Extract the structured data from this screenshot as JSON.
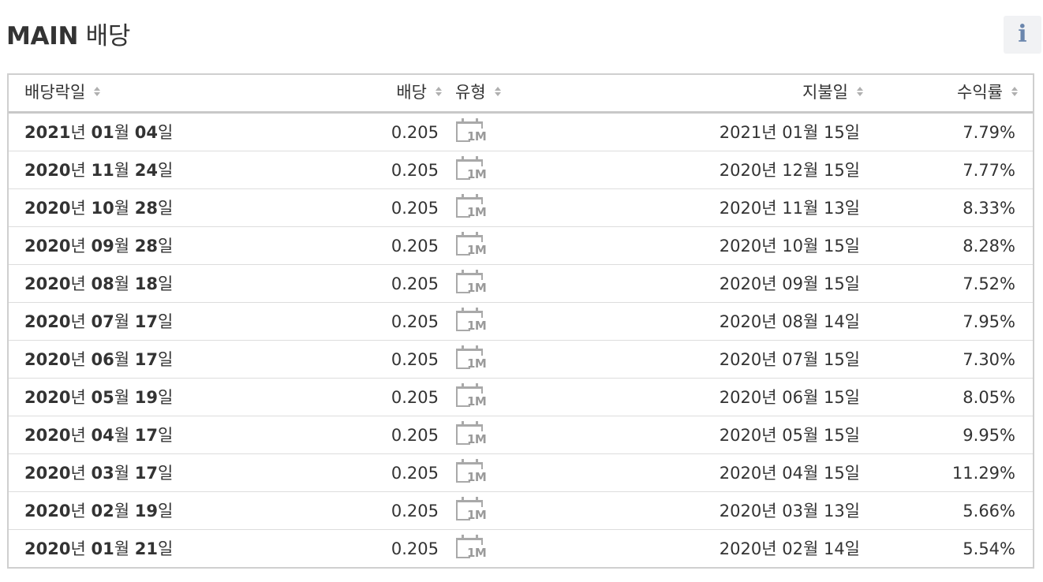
{
  "page": {
    "title_bold": "MAIN",
    "title_rest": " 배당",
    "info_glyph": "i"
  },
  "table": {
    "columns": {
      "ex_date": "배당락일",
      "amount": "배당",
      "type": "유형",
      "pay_date": "지불일",
      "yield": "수익률"
    },
    "rows": [
      {
        "ex_y": "2021",
        "ex_m": "01",
        "ex_d": "04",
        "amount": "0.205",
        "type": "1M",
        "pay_date": "2021년 01월 15일",
        "yield": "7.79%"
      },
      {
        "ex_y": "2020",
        "ex_m": "11",
        "ex_d": "24",
        "amount": "0.205",
        "type": "1M",
        "pay_date": "2020년 12월 15일",
        "yield": "7.77%"
      },
      {
        "ex_y": "2020",
        "ex_m": "10",
        "ex_d": "28",
        "amount": "0.205",
        "type": "1M",
        "pay_date": "2020년 11월 13일",
        "yield": "8.33%"
      },
      {
        "ex_y": "2020",
        "ex_m": "09",
        "ex_d": "28",
        "amount": "0.205",
        "type": "1M",
        "pay_date": "2020년 10월 15일",
        "yield": "8.28%"
      },
      {
        "ex_y": "2020",
        "ex_m": "08",
        "ex_d": "18",
        "amount": "0.205",
        "type": "1M",
        "pay_date": "2020년 09월 15일",
        "yield": "7.52%"
      },
      {
        "ex_y": "2020",
        "ex_m": "07",
        "ex_d": "17",
        "amount": "0.205",
        "type": "1M",
        "pay_date": "2020년 08월 14일",
        "yield": "7.95%"
      },
      {
        "ex_y": "2020",
        "ex_m": "06",
        "ex_d": "17",
        "amount": "0.205",
        "type": "1M",
        "pay_date": "2020년 07월 15일",
        "yield": "7.30%"
      },
      {
        "ex_y": "2020",
        "ex_m": "05",
        "ex_d": "19",
        "amount": "0.205",
        "type": "1M",
        "pay_date": "2020년 06월 15일",
        "yield": "8.05%"
      },
      {
        "ex_y": "2020",
        "ex_m": "04",
        "ex_d": "17",
        "amount": "0.205",
        "type": "1M",
        "pay_date": "2020년 05월 15일",
        "yield": "9.95%"
      },
      {
        "ex_y": "2020",
        "ex_m": "03",
        "ex_d": "17",
        "amount": "0.205",
        "type": "1M",
        "pay_date": "2020년 04월 15일",
        "yield": "11.29%"
      },
      {
        "ex_y": "2020",
        "ex_m": "02",
        "ex_d": "19",
        "amount": "0.205",
        "type": "1M",
        "pay_date": "2020년 03월 13일",
        "yield": "5.66%"
      },
      {
        "ex_y": "2020",
        "ex_m": "01",
        "ex_d": "21",
        "amount": "0.205",
        "type": "1M",
        "pay_date": "2020년 02월 14일",
        "yield": "5.54%"
      }
    ],
    "date_units": {
      "year": "년",
      "month": "월",
      "day": "일"
    }
  },
  "icons": {
    "sort": "sort-arrows-icon",
    "type": "calendar-monthly-icon",
    "info": "info-icon"
  },
  "colors": {
    "info_accent": "#6b86ad",
    "border": "#cfcfcf",
    "icon_gray": "#a9a9a9"
  }
}
